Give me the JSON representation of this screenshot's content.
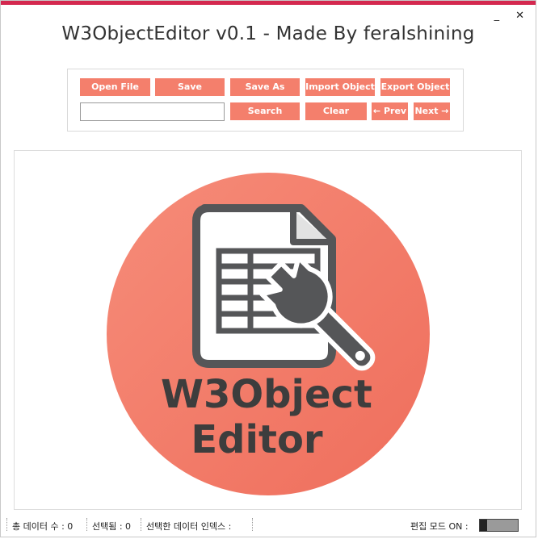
{
  "window": {
    "title": "W3ObjectEditor v0.1 - Made By feralshining",
    "minimize_glyph": "_",
    "close_glyph": "✕",
    "accent_color": "#d4284f"
  },
  "toolbar": {
    "open_file": "Open File",
    "save": "Save",
    "save_as": "Save As",
    "import_object": "Import Object",
    "export_object": "Export Object",
    "search_value": "",
    "search": "Search",
    "clear": "Clear",
    "prev": "← Prev",
    "next": "Next →",
    "button_color": "#f47f6c"
  },
  "logo": {
    "line1": "W3Object",
    "line2": "Editor",
    "icon": "spreadsheet-wrench-icon",
    "circle_color": "#f47f6c",
    "text_color": "#3d3d3d"
  },
  "status": {
    "total": "총 데이터 수 : 0",
    "selected": "선택됨 : 0",
    "selected_index": "선택한 데이터 인덱스 :",
    "edit_mode": "편집 모드 ON :"
  }
}
